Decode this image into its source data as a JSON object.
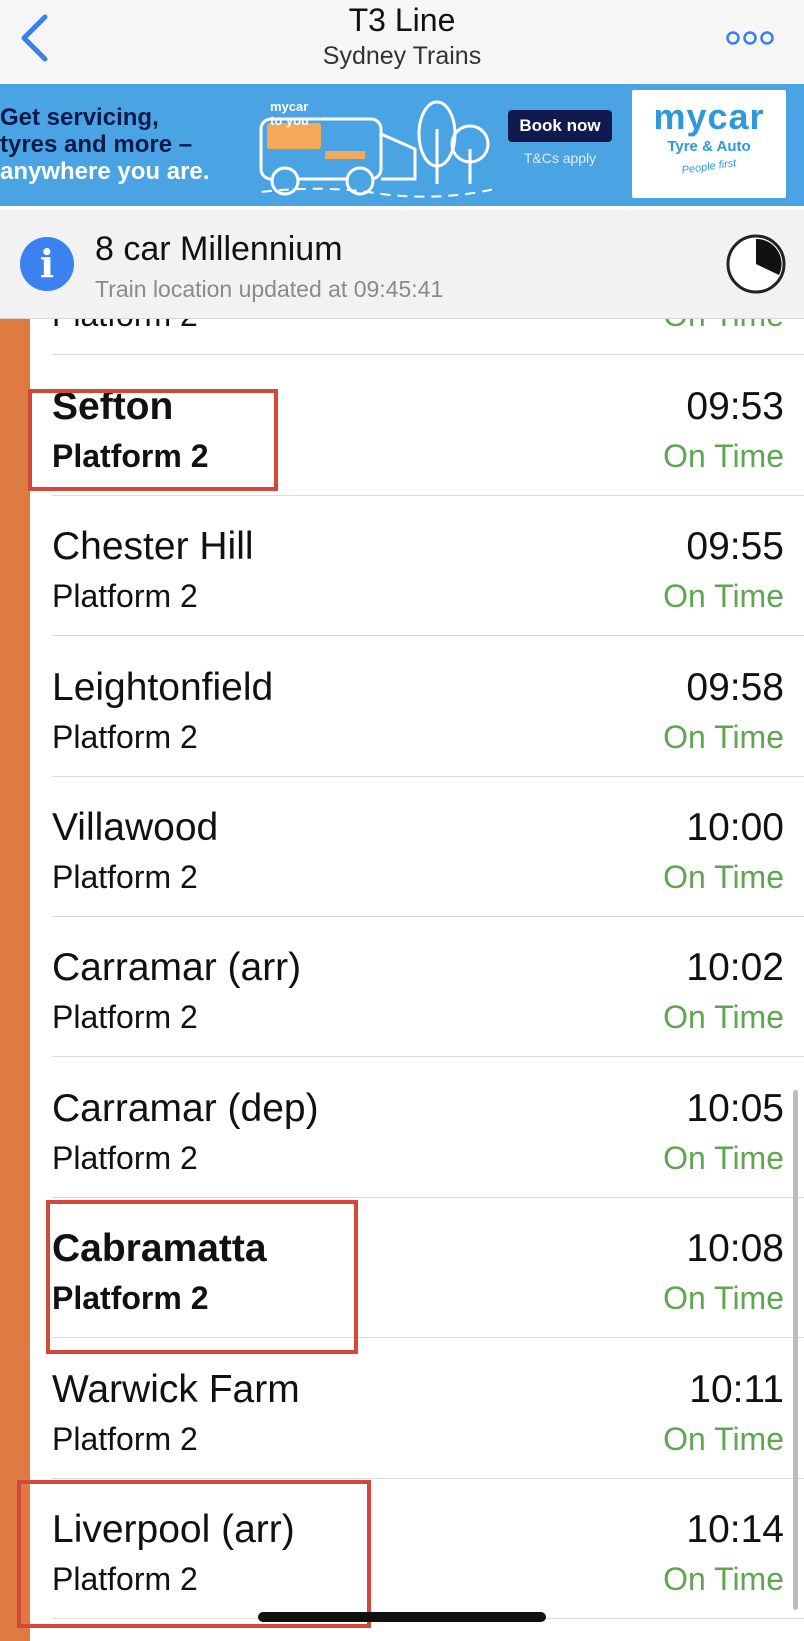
{
  "navbar": {
    "title": "T3 Line",
    "subtitle": "Sydney Trains",
    "back_icon": "chevron-left-icon",
    "more_icon": "ellipsis-icon"
  },
  "ad": {
    "headline_1": "Get servicing,",
    "headline_2": "tyres and more –",
    "headline_3": "anywhere you are.",
    "van_label_1": "mycar",
    "van_label_2": "to you",
    "cta": "Book now",
    "terms": "T&Cs apply",
    "brand": "mycar",
    "brand_sub": "Tyre & Auto",
    "brand_tag": "People first"
  },
  "info": {
    "title": "8 car Millennium",
    "updated": "Train location updated at 09:45:41",
    "icon": "info-icon",
    "timer_icon": "timer-icon"
  },
  "partial_row": {
    "platform": "Platform 2",
    "status": "On Time"
  },
  "stops": [
    {
      "station": "Sefton",
      "platform": "Platform 2",
      "time": "09:53",
      "status": "On Time"
    },
    {
      "station": "Chester Hill",
      "platform": "Platform 2",
      "time": "09:55",
      "status": "On Time"
    },
    {
      "station": "Leightonfield",
      "platform": "Platform 2",
      "time": "09:58",
      "status": "On Time"
    },
    {
      "station": "Villawood",
      "platform": "Platform 2",
      "time": "10:00",
      "status": "On Time"
    },
    {
      "station": "Carramar (arr)",
      "platform": "Platform 2",
      "time": "10:02",
      "status": "On Time"
    },
    {
      "station": "Carramar (dep)",
      "platform": "Platform 2",
      "time": "10:05",
      "status": "On Time"
    },
    {
      "station": "Cabramatta",
      "platform": "Platform 2",
      "time": "10:08",
      "status": "On Time"
    },
    {
      "station": "Warwick Farm",
      "platform": "Platform 2",
      "time": "10:11",
      "status": "On Time"
    },
    {
      "station": "Liverpool (arr)",
      "platform": "Platform 2",
      "time": "10:14",
      "status": "On Time"
    }
  ],
  "colors": {
    "line": "#dd7b43",
    "on_time": "#5fa552",
    "highlight": "#d4483a",
    "accent": "#3b82f0"
  }
}
